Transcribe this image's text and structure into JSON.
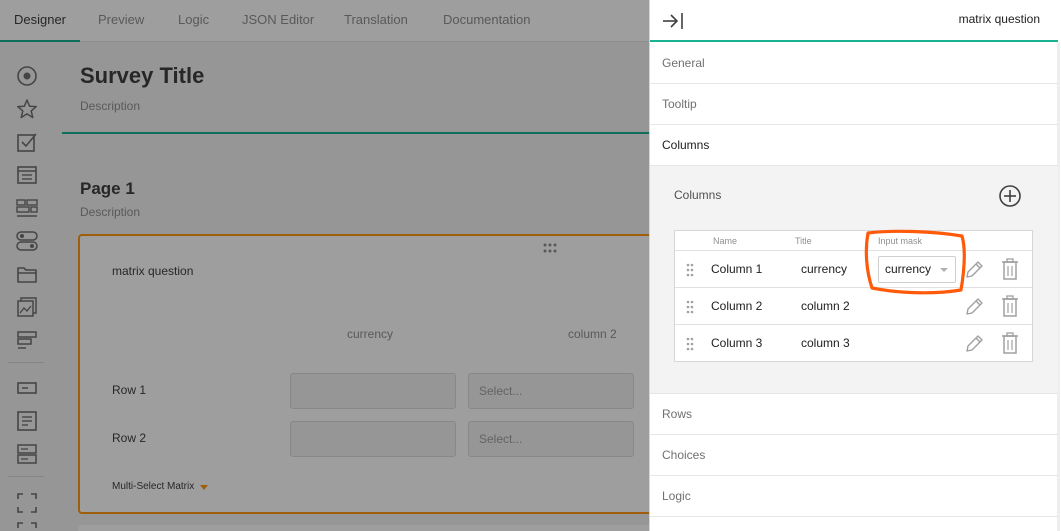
{
  "tabs": [
    "Designer",
    "Preview",
    "Logic",
    "JSON Editor",
    "Translation",
    "Documentation"
  ],
  "toolbox": {
    "icons": [
      "radiogroup-icon",
      "rating-icon",
      "checkbox-icon",
      "dropdown-icon",
      "tagbox-icon",
      "boolean-icon",
      "file-icon",
      "imagepicker-icon",
      "ranking-icon",
      "text-input-icon",
      "comment-icon",
      "multiple-text-icon",
      "panel-icon",
      "panel-dynamic-icon"
    ]
  },
  "survey": {
    "title": "Survey Title",
    "description": "Description",
    "page_title": "Page 1",
    "page_description": "Description",
    "question": {
      "title": "matrix question",
      "columns": [
        "currency",
        "column 2"
      ],
      "rows": [
        "Row 1",
        "Row 2"
      ],
      "select_placeholder": "Select...",
      "type_label": "Multi-Select Matrix"
    }
  },
  "panel": {
    "object_name": "matrix question",
    "sections_top": [
      "General",
      "Tooltip",
      "Columns"
    ],
    "sections_bottom": [
      "Rows",
      "Choices",
      "Logic"
    ],
    "columns_editor": {
      "label": "Columns",
      "headers": {
        "name": "Name",
        "title": "Title",
        "input_mask": "Input mask"
      },
      "rows": [
        {
          "name": "Column 1",
          "title": "currency",
          "input_mask": "currency"
        },
        {
          "name": "Column 2",
          "title": "column 2",
          "input_mask": ""
        },
        {
          "name": "Column 3",
          "title": "column 3",
          "input_mask": ""
        }
      ]
    }
  },
  "colors": {
    "accent": "#19b394",
    "question_border": "#ff9814",
    "annotation": "#ff5a0a"
  }
}
